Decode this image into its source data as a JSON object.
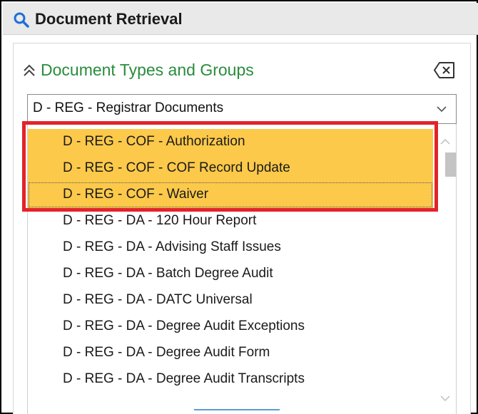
{
  "window": {
    "title": "Document Retrieval",
    "title_icon": "search-icon"
  },
  "section": {
    "title": "Document Types and Groups",
    "collapse_icon": "double-chevron-up-icon",
    "clear_icon": "clear-backspace-icon",
    "accent_color": "#2a8c3d"
  },
  "dropdown": {
    "selected_value": "D - REG - Registrar Documents",
    "chevron_icon": "chevron-down-icon"
  },
  "list": {
    "items": [
      {
        "label": "D - REG - COF - Authorization",
        "selected": true
      },
      {
        "label": "D - REG - COF - COF Record Update",
        "selected": true
      },
      {
        "label": "D - REG - COF - Waiver",
        "selected": true,
        "focused": true
      },
      {
        "label": "D - REG - DA - 120 Hour Report",
        "selected": false
      },
      {
        "label": "D - REG - DA - Advising Staff Issues",
        "selected": false
      },
      {
        "label": "D - REG - DA - Batch Degree Audit",
        "selected": false
      },
      {
        "label": "D - REG - DA - DATC Universal",
        "selected": false
      },
      {
        "label": "D - REG - DA - Degree Audit Exceptions",
        "selected": false
      },
      {
        "label": "D - REG - DA - Degree Audit Form",
        "selected": false
      },
      {
        "label": "D - REG - DA - Degree Audit Transcripts",
        "selected": false
      }
    ],
    "selected_color": "#fcc94a",
    "highlight_color": "#e2232a"
  }
}
